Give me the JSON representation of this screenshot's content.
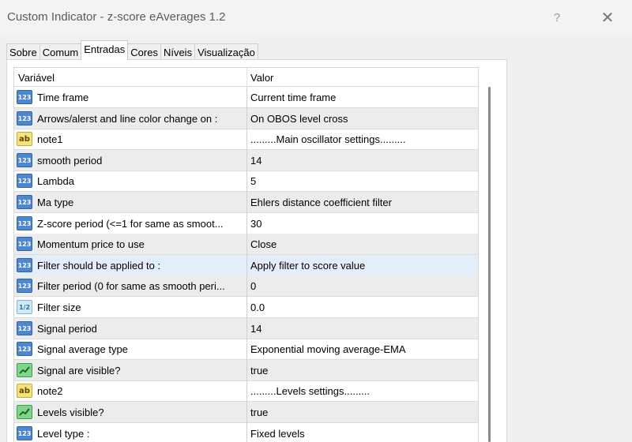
{
  "window": {
    "title": "Custom Indicator - z-score eAverages 1.2",
    "help_label": "?",
    "close_label": "✕"
  },
  "tabs": [
    {
      "label": "Sobre"
    },
    {
      "label": "Comum"
    },
    {
      "label": "Entradas",
      "active": true
    },
    {
      "label": "Cores"
    },
    {
      "label": "Níveis"
    },
    {
      "label": "Visualização"
    }
  ],
  "grid": {
    "headers": {
      "name": "Variável",
      "value": "Valor"
    },
    "rows": [
      {
        "icon": "int-icon",
        "name": "Time frame",
        "value": "Current time frame"
      },
      {
        "icon": "int-icon",
        "name": "Arrows/alerst and line color change on :",
        "value": "On OBOS level cross"
      },
      {
        "icon": "string-icon",
        "name": "note1",
        "value": ".........Main oscillator settings........."
      },
      {
        "icon": "int-icon",
        "name": "smooth period",
        "value": "14"
      },
      {
        "icon": "int-icon",
        "name": "Lambda",
        "value": "5"
      },
      {
        "icon": "int-icon",
        "name": "Ma type",
        "value": "Ehlers distance coefficient filter"
      },
      {
        "icon": "int-icon",
        "name": "Z-score period (<=1 for same as smoot...",
        "value": "30"
      },
      {
        "icon": "int-icon",
        "name": "Momentum  price to use",
        "value": "Close"
      },
      {
        "icon": "int-icon",
        "name": "Filter should be applied to :",
        "value": "Apply filter to score value",
        "selected": true
      },
      {
        "icon": "int-icon",
        "name": "Filter period (0 for same as smooth peri...",
        "value": "0"
      },
      {
        "icon": "double-icon",
        "name": "Filter size",
        "value": "0.0"
      },
      {
        "icon": "int-icon",
        "name": "Signal period",
        "value": "14"
      },
      {
        "icon": "int-icon",
        "name": "Signal average type",
        "value": "Exponential moving average-EMA"
      },
      {
        "icon": "bool-icon",
        "name": "Signal are visible?",
        "value": "true"
      },
      {
        "icon": "string-icon",
        "name": "note2",
        "value": ".........Levels settings........."
      },
      {
        "icon": "bool-icon",
        "name": "Levels visible?",
        "value": "true"
      },
      {
        "icon": "int-icon",
        "name": "Level type :",
        "value": "Fixed levels"
      }
    ]
  }
}
